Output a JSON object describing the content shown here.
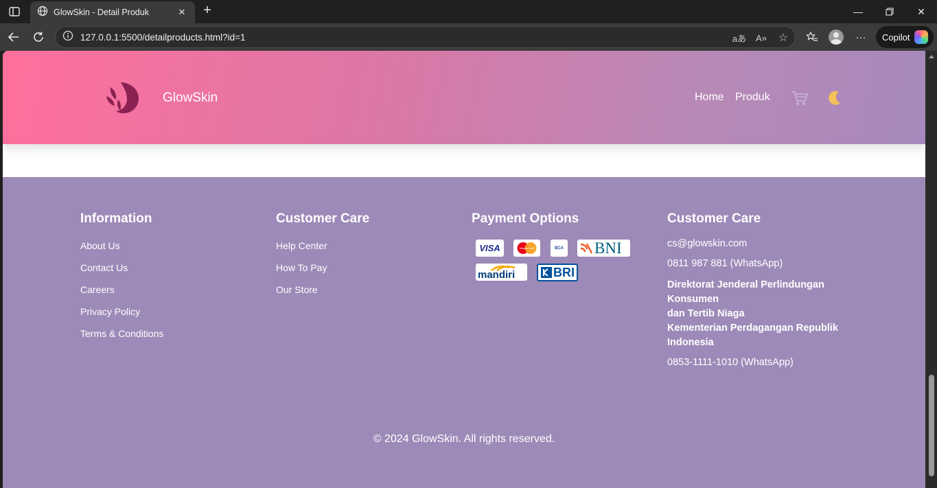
{
  "browser": {
    "tab_title": "GlowSkin - Detail Produk",
    "url": "127.0.0.1:5500/detailproducts.html?id=1",
    "copilot_label": "Copilot",
    "reader_text": "aあ",
    "read_aloud_text": "A»"
  },
  "header": {
    "brand": "GlowSkin",
    "nav": [
      "Home",
      "Produk"
    ],
    "accent_color": "#ff6f9c"
  },
  "footer": {
    "background_color": "#9d8ab8",
    "information": {
      "title": "Information",
      "links": [
        "About Us",
        "Contact Us",
        "Careers",
        "Privacy Policy",
        "Terms & Conditions"
      ]
    },
    "customer_care": {
      "title": "Customer Care",
      "links": [
        "Help Center",
        "How To Pay",
        "Our Store"
      ]
    },
    "payment": {
      "title": "Payment Options",
      "methods": [
        "VISA",
        "MasterCard",
        "BCA",
        "BNI",
        "mandiri",
        "BRI"
      ]
    },
    "contact": {
      "title": "Customer Care",
      "email": "cs@glowskin.com",
      "phone": "0811 987 881 (WhatsApp)",
      "address_lines": [
        "Direktorat Jenderal Perlindungan Konsumen",
        "dan Tertib Niaga",
        "Kementerian Perdagangan Republik Indonesia"
      ],
      "phone2": "0853-1111-1010 (WhatsApp)"
    },
    "copyright": "© 2024 GlowSkin. All rights reserved."
  }
}
